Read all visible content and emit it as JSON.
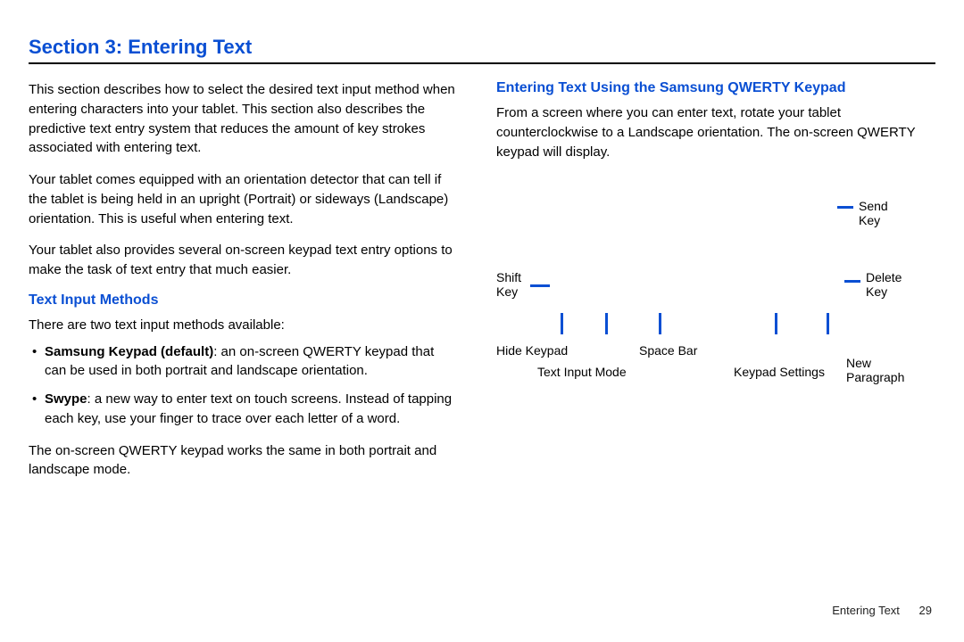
{
  "section_title": "Section 3: Entering Text",
  "intro_p1": "This section describes how to select the desired text input method when entering characters into your tablet. This section also describes the predictive text entry system that reduces the amount of key strokes associated with entering text.",
  "intro_p2": "Your tablet comes equipped with an orientation detector that can tell if the tablet is being held in an upright (Portrait) or sideways (Landscape) orientation. This is useful when entering text.",
  "intro_p3": "Your tablet also provides several on-screen keypad text entry options to make the task of text entry that much easier.",
  "sub1_title": "Text Input Methods",
  "sub1_intro": "There are two text input methods available:",
  "bullet1_bold": "Samsung Keypad (default)",
  "bullet1_rest": ": an on-screen QWERTY keypad that can be used in both portrait and landscape orientation.",
  "bullet2_bold": "Swype",
  "bullet2_rest": ": a new way to enter text on touch screens. Instead of tapping each key, use your finger to trace over each letter of a word.",
  "sub1_outro": "The on-screen QWERTY keypad works the same in both portrait and landscape mode.",
  "sub2_title": "Entering Text Using the Samsung QWERTY Keypad",
  "sub2_p1": "From a screen where you can enter text, rotate your tablet counterclockwise to a Landscape orientation. The on-screen QWERTY keypad will display.",
  "labels": {
    "send_key": "Send Key",
    "shift_key": "Shift Key",
    "delete_key": "Delete Key",
    "hide_keypad": "Hide Keypad",
    "text_input_mode": "Text Input Mode",
    "space_bar": "Space Bar",
    "keypad_settings": "Keypad Settings",
    "new_paragraph": "New Paragraph"
  },
  "footer_text": "Entering Text",
  "page_number": "29"
}
